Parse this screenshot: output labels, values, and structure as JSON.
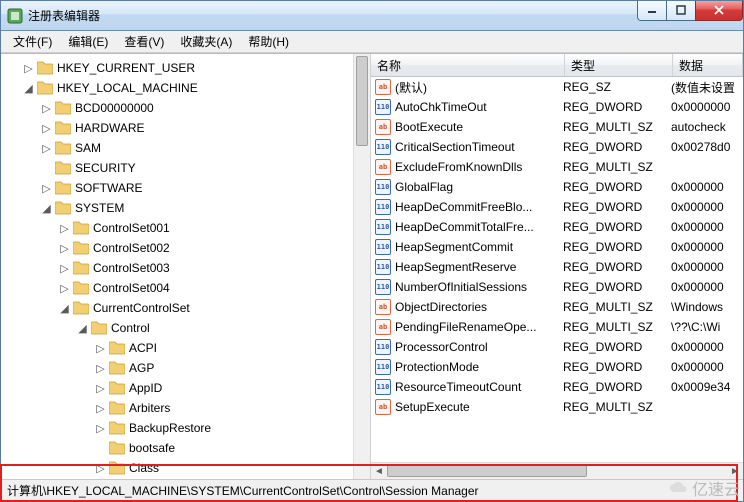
{
  "window": {
    "title": "注册表编辑器"
  },
  "menu": {
    "file": "文件(F)",
    "edit": "编辑(E)",
    "view": "查看(V)",
    "favorites": "收藏夹(A)",
    "help": "帮助(H)"
  },
  "tree": [
    {
      "lvl": 1,
      "exp": "▷",
      "label": "HKEY_CURRENT_USER"
    },
    {
      "lvl": 1,
      "exp": "◢",
      "label": "HKEY_LOCAL_MACHINE"
    },
    {
      "lvl": 2,
      "exp": "▷",
      "label": "BCD00000000"
    },
    {
      "lvl": 2,
      "exp": "▷",
      "label": "HARDWARE"
    },
    {
      "lvl": 2,
      "exp": "▷",
      "label": "SAM"
    },
    {
      "lvl": 2,
      "exp": "",
      "label": "SECURITY"
    },
    {
      "lvl": 2,
      "exp": "▷",
      "label": "SOFTWARE"
    },
    {
      "lvl": 2,
      "exp": "◢",
      "label": "SYSTEM"
    },
    {
      "lvl": 3,
      "exp": "▷",
      "label": "ControlSet001"
    },
    {
      "lvl": 3,
      "exp": "▷",
      "label": "ControlSet002"
    },
    {
      "lvl": 3,
      "exp": "▷",
      "label": "ControlSet003"
    },
    {
      "lvl": 3,
      "exp": "▷",
      "label": "ControlSet004"
    },
    {
      "lvl": 3,
      "exp": "◢",
      "label": "CurrentControlSet"
    },
    {
      "lvl": 4,
      "exp": "◢",
      "label": "Control"
    },
    {
      "lvl": 5,
      "exp": "▷",
      "label": "ACPI"
    },
    {
      "lvl": 5,
      "exp": "▷",
      "label": "AGP"
    },
    {
      "lvl": 5,
      "exp": "▷",
      "label": "AppID"
    },
    {
      "lvl": 5,
      "exp": "▷",
      "label": "Arbiters"
    },
    {
      "lvl": 5,
      "exp": "▷",
      "label": "BackupRestore"
    },
    {
      "lvl": 5,
      "exp": "",
      "label": "bootsafe"
    },
    {
      "lvl": 5,
      "exp": "▷",
      "label": "Class"
    }
  ],
  "columns": {
    "name": "名称",
    "type": "类型",
    "data": "数据"
  },
  "values": [
    {
      "icon": "sz",
      "name": "(默认)",
      "type": "REG_SZ",
      "data": "(数值未设置"
    },
    {
      "icon": "dw",
      "name": "AutoChkTimeOut",
      "type": "REG_DWORD",
      "data": "0x0000000"
    },
    {
      "icon": "sz",
      "name": "BootExecute",
      "type": "REG_MULTI_SZ",
      "data": "autocheck"
    },
    {
      "icon": "dw",
      "name": "CriticalSectionTimeout",
      "type": "REG_DWORD",
      "data": "0x00278d0"
    },
    {
      "icon": "sz",
      "name": "ExcludeFromKnownDlls",
      "type": "REG_MULTI_SZ",
      "data": ""
    },
    {
      "icon": "dw",
      "name": "GlobalFlag",
      "type": "REG_DWORD",
      "data": "0x000000"
    },
    {
      "icon": "dw",
      "name": "HeapDeCommitFreeBlo...",
      "type": "REG_DWORD",
      "data": "0x000000"
    },
    {
      "icon": "dw",
      "name": "HeapDeCommitTotalFre...",
      "type": "REG_DWORD",
      "data": "0x000000"
    },
    {
      "icon": "dw",
      "name": "HeapSegmentCommit",
      "type": "REG_DWORD",
      "data": "0x000000"
    },
    {
      "icon": "dw",
      "name": "HeapSegmentReserve",
      "type": "REG_DWORD",
      "data": "0x000000"
    },
    {
      "icon": "dw",
      "name": "NumberOfInitialSessions",
      "type": "REG_DWORD",
      "data": "0x000000"
    },
    {
      "icon": "sz",
      "name": "ObjectDirectories",
      "type": "REG_MULTI_SZ",
      "data": "\\Windows"
    },
    {
      "icon": "sz",
      "name": "PendingFileRenameOpe...",
      "type": "REG_MULTI_SZ",
      "data": "\\??\\C:\\Wi"
    },
    {
      "icon": "dw",
      "name": "ProcessorControl",
      "type": "REG_DWORD",
      "data": "0x000000"
    },
    {
      "icon": "dw",
      "name": "ProtectionMode",
      "type": "REG_DWORD",
      "data": "0x000000"
    },
    {
      "icon": "dw",
      "name": "ResourceTimeoutCount",
      "type": "REG_DWORD",
      "data": "0x0009e34"
    },
    {
      "icon": "sz",
      "name": "SetupExecute",
      "type": "REG_MULTI_SZ",
      "data": ""
    }
  ],
  "statusbar": {
    "path": "计算机\\HKEY_LOCAL_MACHINE\\SYSTEM\\CurrentControlSet\\Control\\Session Manager"
  },
  "watermark": "亿速云"
}
